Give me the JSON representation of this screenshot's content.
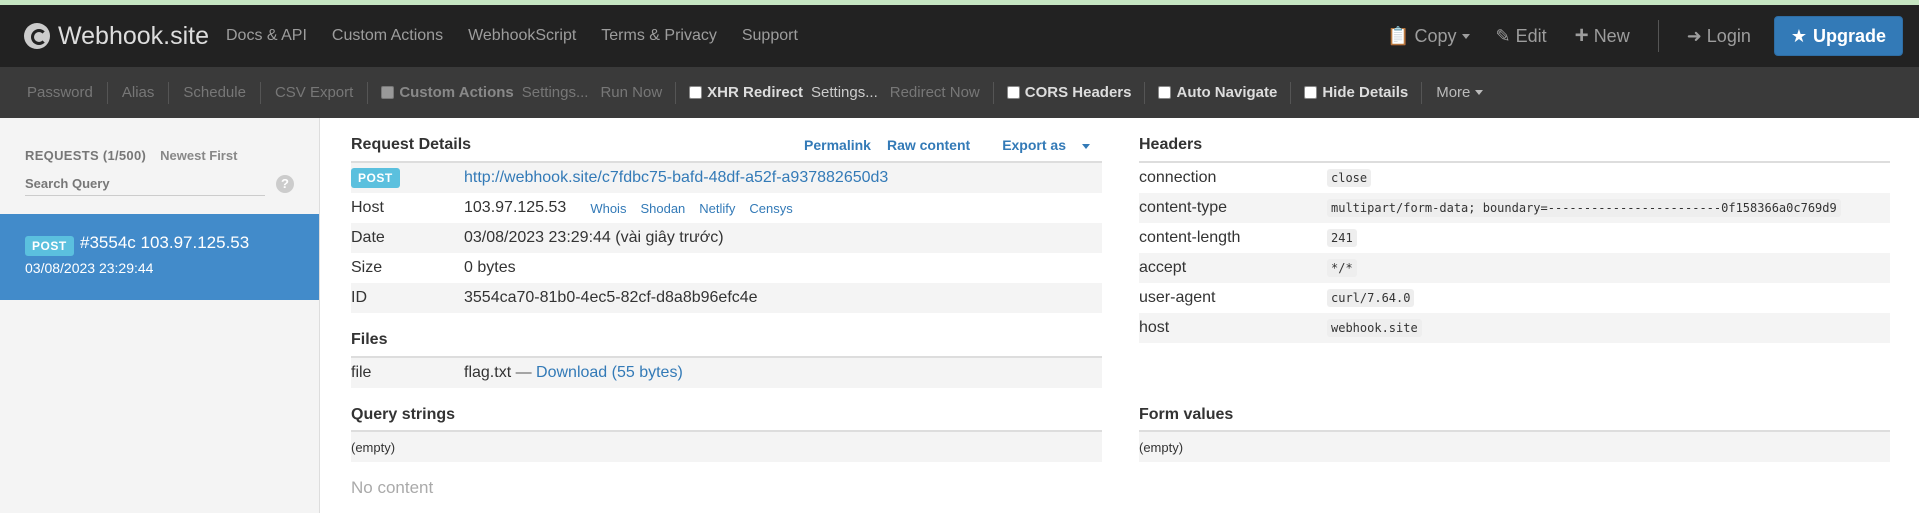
{
  "navbar": {
    "brand": "Webhook.site",
    "links": [
      "Docs & API",
      "Custom Actions",
      "WebhookScript",
      "Terms & Privacy",
      "Support"
    ],
    "copy": "Copy",
    "edit": "Edit",
    "new": "New",
    "login": "Login",
    "upgrade": "Upgrade"
  },
  "subbar": {
    "password": "Password",
    "alias": "Alias",
    "schedule": "Schedule",
    "csv_export": "CSV Export",
    "custom_actions": {
      "label": "Custom Actions",
      "settings": "Settings...",
      "run": "Run Now"
    },
    "xhr_redirect": {
      "label": "XHR Redirect",
      "settings": "Settings...",
      "redirect": "Redirect Now"
    },
    "cors_headers": "CORS Headers",
    "auto_navigate": "Auto Navigate",
    "hide_details": "Hide Details",
    "more": "More"
  },
  "sidebar": {
    "requests_count": "REQUESTS (1/500)",
    "sort": "Newest First",
    "search_placeholder": "Search Query",
    "help": "?",
    "items": [
      {
        "method": "POST",
        "title": "#3554c 103.97.125.53",
        "time": "03/08/2023 23:29:44"
      }
    ]
  },
  "request_details": {
    "title": "Request Details",
    "links": {
      "permalink": "Permalink",
      "raw": "Raw content",
      "export": "Export as"
    },
    "method": "POST",
    "url": "http://webhook.site/c7fdbc75-bafd-48df-a52f-a937882650d3",
    "host_label": "Host",
    "host": "103.97.125.53",
    "host_links": [
      "Whois",
      "Shodan",
      "Netlify",
      "Censys"
    ],
    "date_label": "Date",
    "date": "03/08/2023 23:29:44 (vài giây trước)",
    "size_label": "Size",
    "size": "0 bytes",
    "id_label": "ID",
    "id": "3554ca70-81b0-4ec5-82cf-d8a8b96efc4e"
  },
  "files": {
    "title": "Files",
    "key": "file",
    "name": "flag.txt",
    "sep": " — ",
    "download": "Download (55 bytes)"
  },
  "query_strings": {
    "title": "Query strings",
    "empty": "(empty)"
  },
  "no_content": "No content",
  "headers": {
    "title": "Headers",
    "rows": [
      {
        "key": "connection",
        "value": "close"
      },
      {
        "key": "content-type",
        "value": "multipart/form-data; boundary=------------------------0f158366a0c769d9"
      },
      {
        "key": "content-length",
        "value": "241"
      },
      {
        "key": "accept",
        "value": "*/*"
      },
      {
        "key": "user-agent",
        "value": "curl/7.64.0"
      },
      {
        "key": "host",
        "value": "webhook.site"
      }
    ]
  },
  "form_values": {
    "title": "Form values",
    "empty": "(empty)"
  }
}
